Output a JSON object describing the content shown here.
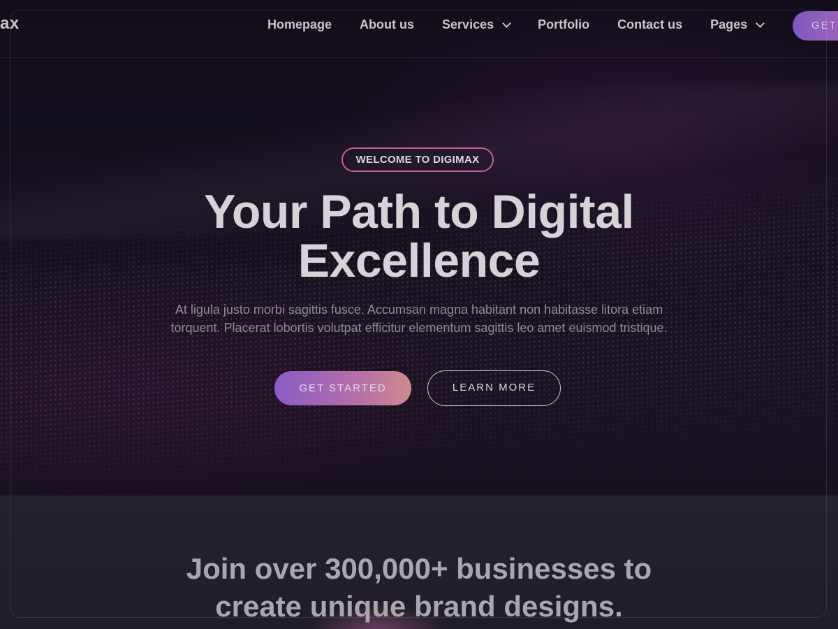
{
  "nav": {
    "logo": "ax",
    "items": [
      {
        "label": "Homepage",
        "has_dropdown": false
      },
      {
        "label": "About us",
        "has_dropdown": false
      },
      {
        "label": "Services",
        "has_dropdown": true
      },
      {
        "label": "Portfolio",
        "has_dropdown": false
      },
      {
        "label": "Contact us",
        "has_dropdown": false
      },
      {
        "label": "Pages",
        "has_dropdown": true
      }
    ],
    "cta_label": "GET",
    "dropdown_icon": "chevron-down-icon"
  },
  "hero": {
    "badge": "WELCOME TO DIGIMAX",
    "title_line1": "Your Path to Digital",
    "title_line2": "Excellence",
    "description": "At ligula justo morbi sagittis fusce. Accumsan magna habitant non habitasse litora etiam torquent. Placerat lobortis volutpat efficitur elementum sagittis leo amet euismod tristique.",
    "primary_button": "GET STARTED",
    "secondary_button": "LEARN MORE"
  },
  "section": {
    "title_line1": "Join over 300,000+ businesses to",
    "title_line2": "create unique brand designs."
  },
  "colors": {
    "accent_purple": "#8b5cc7",
    "accent_pink": "#c7609a",
    "background": "#140f1a"
  }
}
